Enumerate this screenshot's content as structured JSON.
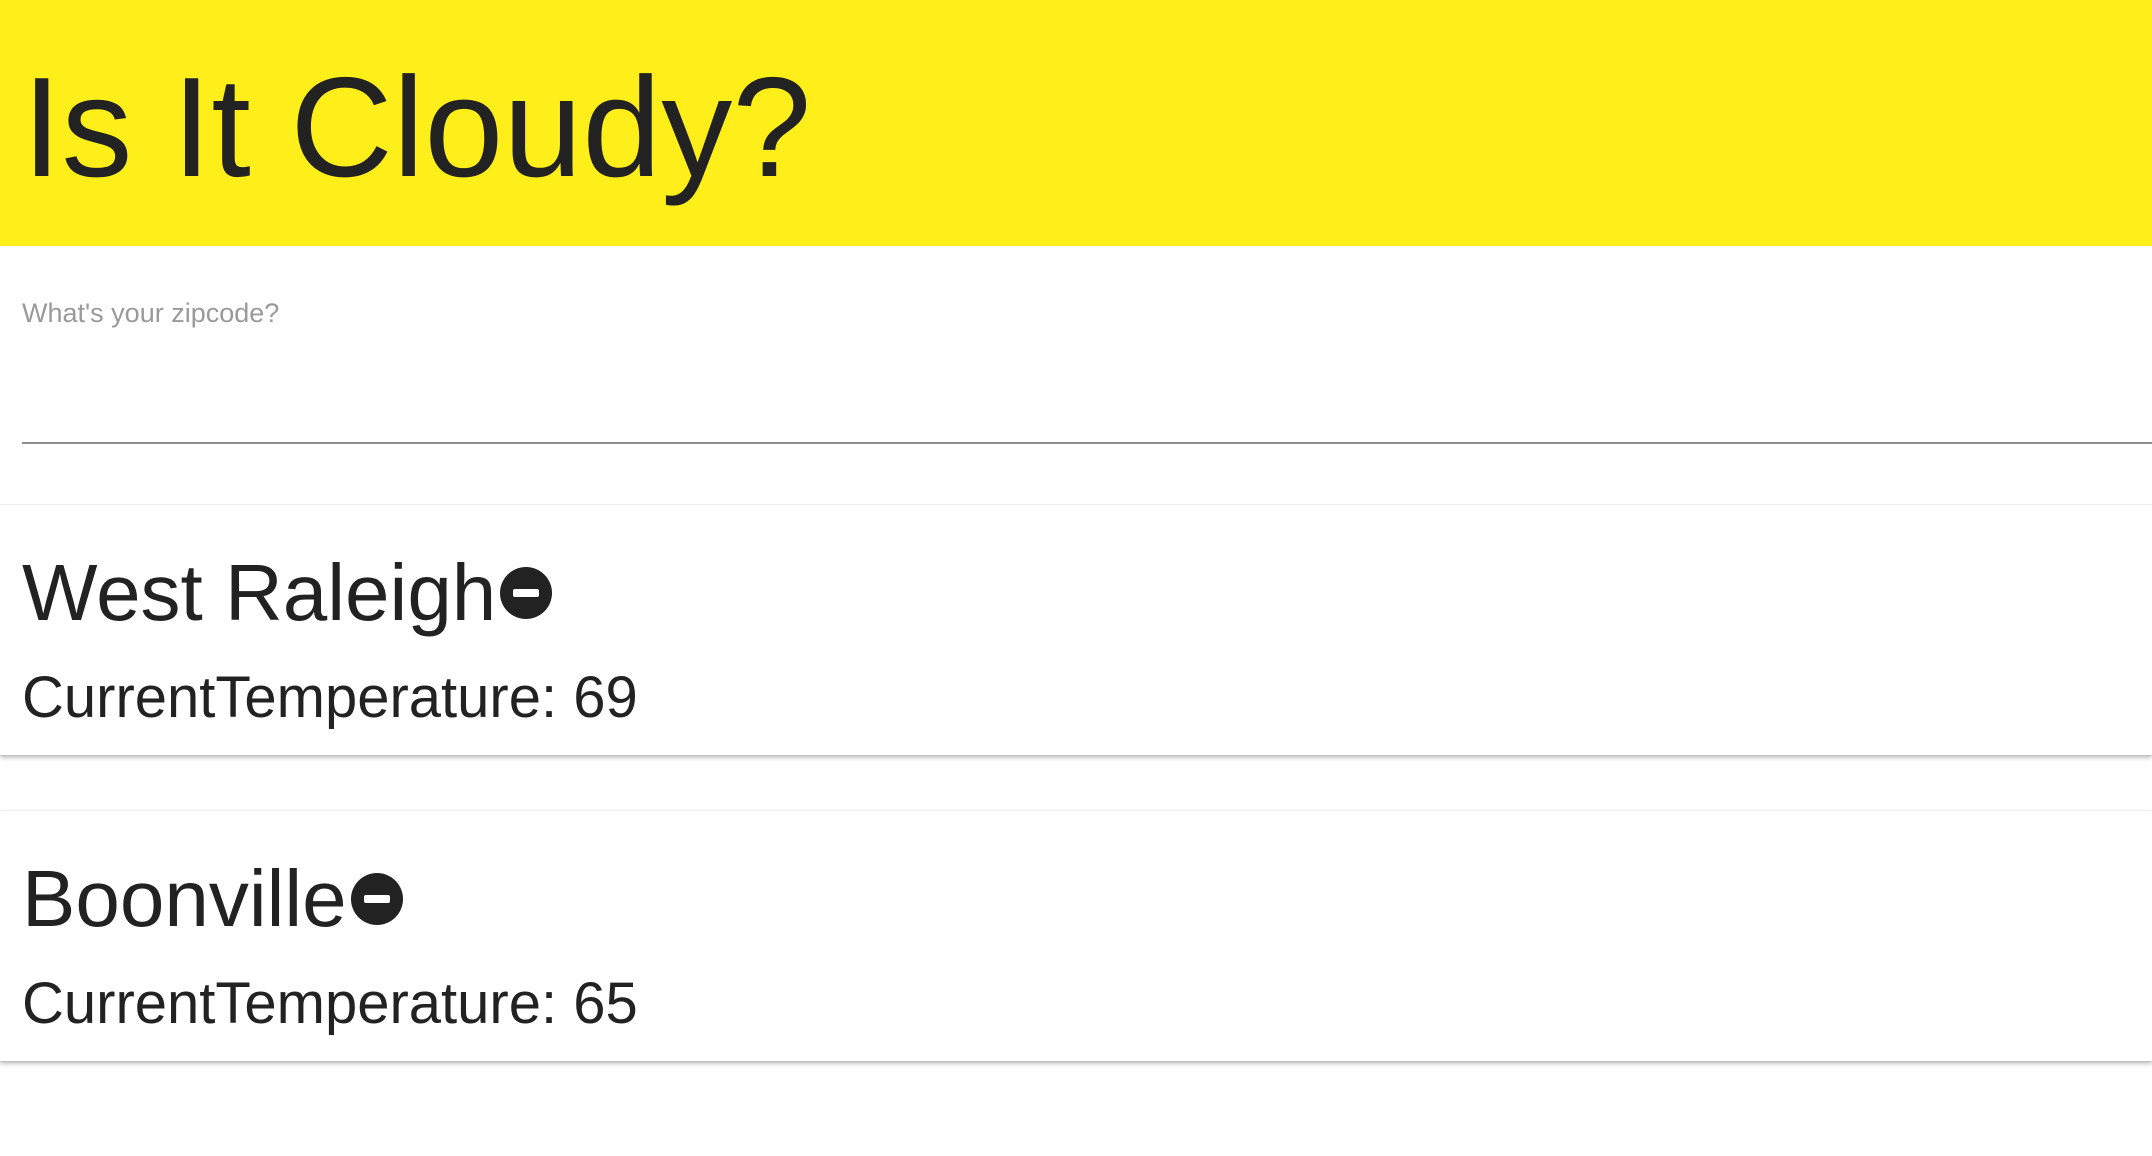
{
  "header": {
    "title": "Is It Cloudy?",
    "background_color": "#feee1a"
  },
  "zip": {
    "label": "What's your zipcode?",
    "value": ""
  },
  "locations": [
    {
      "name": "West Raleigh",
      "temperature_label": "CurrentTemperature:",
      "temperature": "69",
      "remove_icon": "remove-circle-icon"
    },
    {
      "name": "Boonville",
      "temperature_label": "CurrentTemperature:",
      "temperature": "65",
      "remove_icon": "remove-circle-icon"
    }
  ]
}
